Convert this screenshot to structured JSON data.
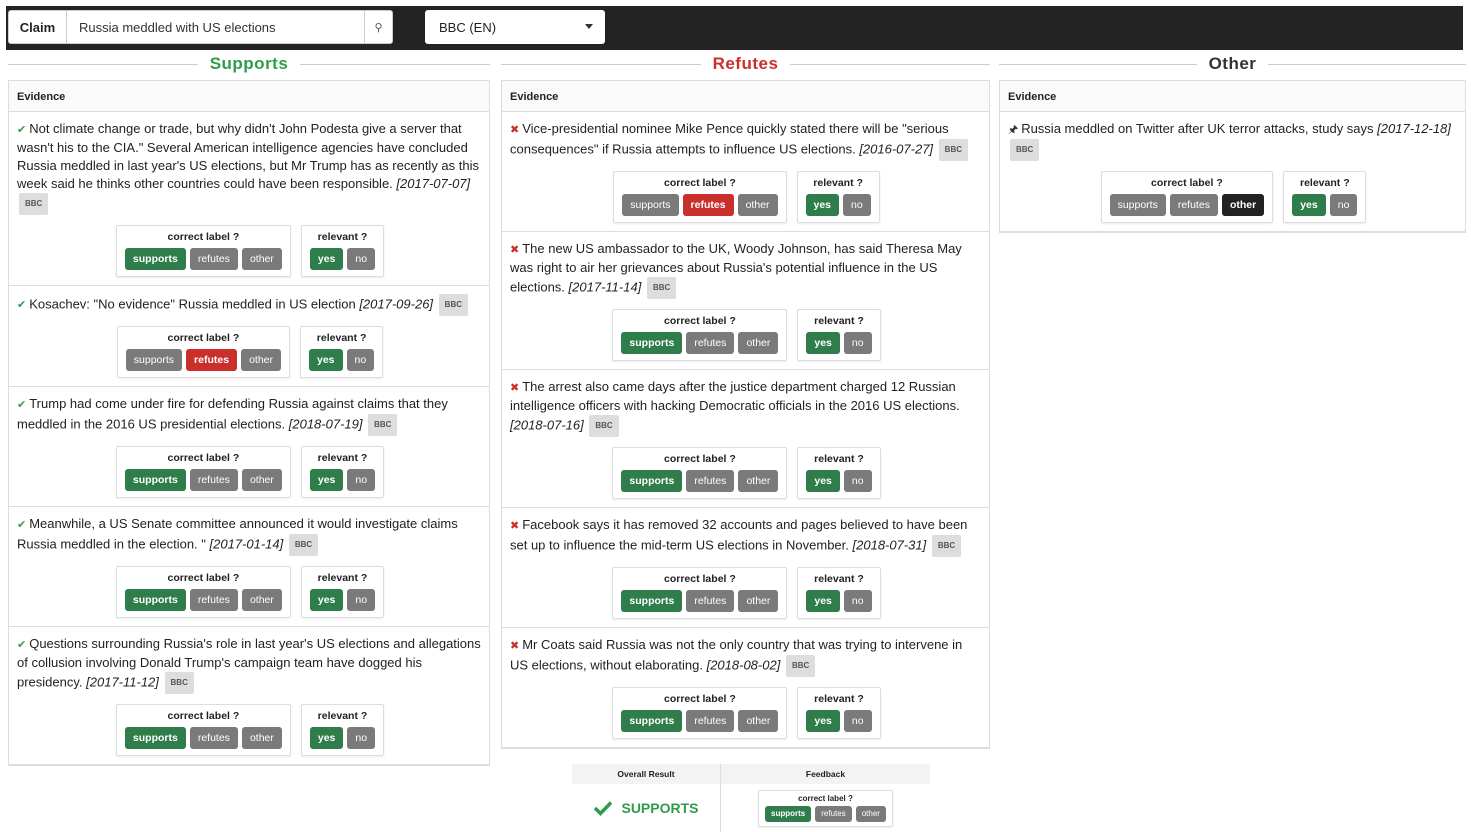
{
  "search": {
    "claim_label": "Claim",
    "claim_value": "Russia meddled with US elections",
    "source_selected": "BBC (EN)"
  },
  "labels": {
    "correct": "correct label ?",
    "relevant": "relevant ?",
    "supports": "supports",
    "refutes": "refutes",
    "other": "other",
    "yes": "yes",
    "no": "no",
    "evidence_header": "Evidence"
  },
  "columns": [
    {
      "title": "Supports",
      "color": "#2e9d4a",
      "marker": "✔",
      "items": [
        {
          "text": "Not climate change or trade, but why didn't John Podesta give a server that wasn't his to the CIA.\" Several American intelligence agencies have concluded Russia meddled in last year's US elections, but Mr Trump has as recently as this week said he thinks other countries could have been responsible.",
          "date": "[2017-07-07]",
          "source": "BBC",
          "label": "supports",
          "relevant": "yes"
        },
        {
          "text": "Kosachev: \"No evidence\" Russia meddled in US election",
          "date": "[2017-09-26]",
          "source": "BBC",
          "label": "refutes",
          "relevant": "yes"
        },
        {
          "text": "Trump had come under fire for defending Russia against claims that they meddled in the 2016 US presidential elections.",
          "date": "[2018-07-19]",
          "source": "BBC",
          "label": "supports",
          "relevant": "yes"
        },
        {
          "text": "Meanwhile, a US Senate committee announced it would investigate claims Russia meddled in the election. \"",
          "date": "[2017-01-14]",
          "source": "BBC",
          "label": "supports",
          "relevant": "yes"
        },
        {
          "text": "Questions surrounding Russia's role in last year's US elections and allegations of collusion involving Donald Trump's campaign team have dogged his presidency.",
          "date": "[2017-11-12]",
          "source": "BBC",
          "label": "supports",
          "relevant": "yes"
        }
      ]
    },
    {
      "title": "Refutes",
      "color": "#c9302c",
      "marker": "✖",
      "items": [
        {
          "text": "Vice-presidential nominee Mike Pence quickly stated there will be \"serious consequences\" if Russia attempts to influence US elections.",
          "date": "[2016-07-27]",
          "source": "BBC",
          "label": "refutes",
          "relevant": "yes"
        },
        {
          "text": "The new US ambassador to the UK, Woody Johnson, has said Theresa May was right to air her grievances about Russia's potential influence in the US elections.",
          "date": "[2017-11-14]",
          "source": "BBC",
          "label": "supports",
          "relevant": "yes"
        },
        {
          "text": "The arrest also came days after the justice department charged 12 Russian intelligence officers with hacking Democratic officials in the 2016 US elections.",
          "date": "[2018-07-16]",
          "source": "BBC",
          "label": "supports",
          "relevant": "yes"
        },
        {
          "text": "Facebook says it has removed 32 accounts and pages believed to have been set up to influence the mid-term US elections in November.",
          "date": "[2018-07-31]",
          "source": "BBC",
          "label": "supports",
          "relevant": "yes"
        },
        {
          "text": "Mr Coats said Russia was not the only country that was trying to intervene in US elections, without elaborating.",
          "date": "[2018-08-02]",
          "source": "BBC",
          "label": "supports",
          "relevant": "yes"
        }
      ]
    },
    {
      "title": "Other",
      "color": "#333333",
      "marker": "🖈",
      "items": [
        {
          "text": "Russia meddled on Twitter after UK terror attacks, study says",
          "date": "[2017-12-18]",
          "source": "BBC",
          "label": "other",
          "relevant": "yes"
        }
      ]
    }
  ],
  "result": {
    "overall_header": "Overall Result",
    "feedback_header": "Feedback",
    "verdict": "SUPPORTS",
    "verdict_icon": "check-icon",
    "feedback_label": "supports"
  }
}
